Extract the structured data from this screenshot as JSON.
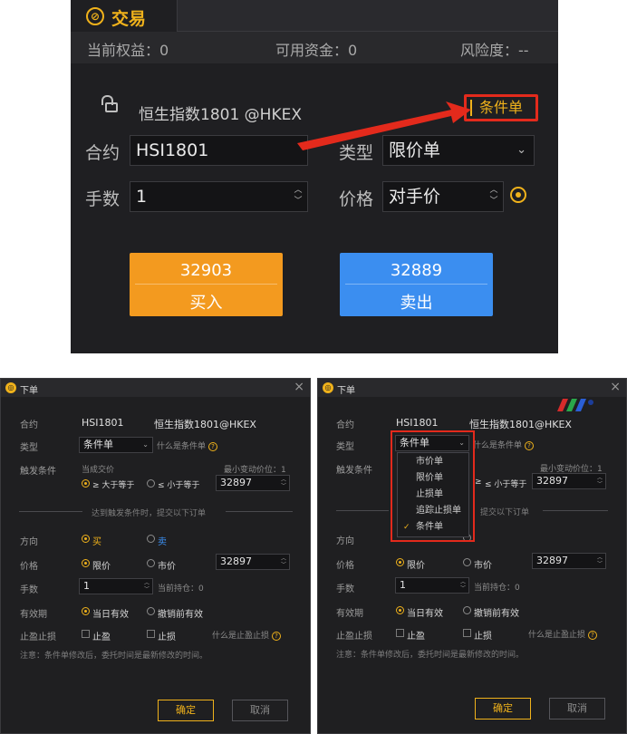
{
  "top_panel": {
    "tab_label": "交易",
    "equity": "当前权益：0",
    "available": "可用资金：0",
    "risk": "风险度：--",
    "contract_display": "恒生指数1801 @HKEX",
    "conditional_button": "条件单",
    "contract_label": "合约",
    "contract_value": "HSI1801",
    "type_label": "类型",
    "type_value": "限价单",
    "qty_label": "手数",
    "qty_value": "1",
    "price_label": "价格",
    "price_value": "对手价",
    "buy_price": "32903",
    "buy_label": "买入",
    "sell_price": "32889",
    "sell_label": "卖出"
  },
  "dialog": {
    "title": "下单",
    "contract_label": "合约",
    "contract_value": "HSI1801",
    "contract_name": "恒生指数1801@HKEX",
    "type_label": "类型",
    "type_value": "条件单",
    "what_is_conditional": "什么是条件单",
    "trigger_label": "触发条件",
    "last_price": "当成交价",
    "min_tick": "最小变动价位：1",
    "gte": "≥ 大于等于",
    "lte": "≤ 小于等于",
    "trigger_price": "32897",
    "submit_hint": "达到触发条件时，提交以下订单",
    "direction_label": "方向",
    "buy": "买",
    "sell": "卖",
    "price_label": "价格",
    "limit_price": "限价",
    "market_price": "市价",
    "price_value": "32897",
    "qty_label": "手数",
    "qty_value": "1",
    "position": "当前持仓：0",
    "validity_label": "有效期",
    "today_valid": "当日有效",
    "until_cancel": "撤销前有效",
    "stop_label": "止盈止损",
    "take_profit": "止盈",
    "stop_loss": "止损",
    "what_is_stop": "什么是止盈止损",
    "note": "注意：条件单修改后，委托时间是最新修改的时间。",
    "ok": "确定",
    "cancel": "取消"
  },
  "dialog_right": {
    "before_trigger": "≥",
    "submit_hint_partial": "提交以下订单",
    "dropdown_options": [
      "市价单",
      "限价单",
      "止损单",
      "追踪止损单",
      "条件单"
    ],
    "selected_option": "条件单"
  },
  "colors": {
    "accent": "#f0b21b",
    "buy": "#f39a1f",
    "sell": "#3b8ef0",
    "highlight": "#e32a1c",
    "panel_bg": "#1f1f22"
  }
}
